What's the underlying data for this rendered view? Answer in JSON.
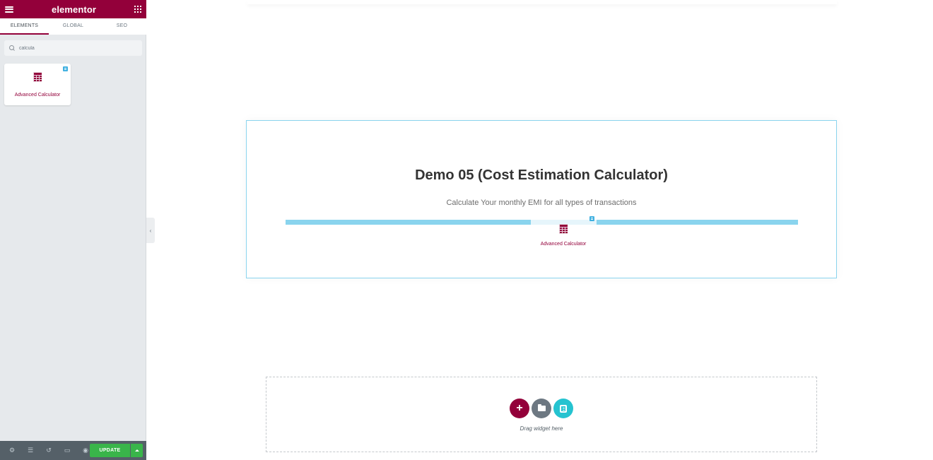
{
  "panel": {
    "logo": "elementor",
    "tabs": [
      "ELEMENTS",
      "GLOBAL",
      "SEO"
    ],
    "active_tab": "ELEMENTS",
    "search": {
      "value": "calcula",
      "placeholder": "Search Widget..."
    },
    "widgets": [
      {
        "label": "Advanced Calculator",
        "icon": "calculator-icon",
        "badge": "pro-badge-icon"
      }
    ],
    "footer": {
      "icons": [
        "settings-icon",
        "navigator-icon",
        "history-icon",
        "responsive-icon",
        "preview-icon"
      ],
      "update_label": "UPDATE"
    }
  },
  "canvas": {
    "section": {
      "title": "Demo 05 (Cost Estimation Calculator)",
      "subtitle": "Calculate Your monthly EMI for all types of transactions",
      "placed_widget_label": "Advanced Calculator"
    },
    "empty_section": {
      "drag_text": "Drag widget here"
    }
  },
  "colors": {
    "brand": "#93003a",
    "update": "#39b54a",
    "drop_indicator": "#8ad4ee",
    "kit": "#25c3d0"
  }
}
